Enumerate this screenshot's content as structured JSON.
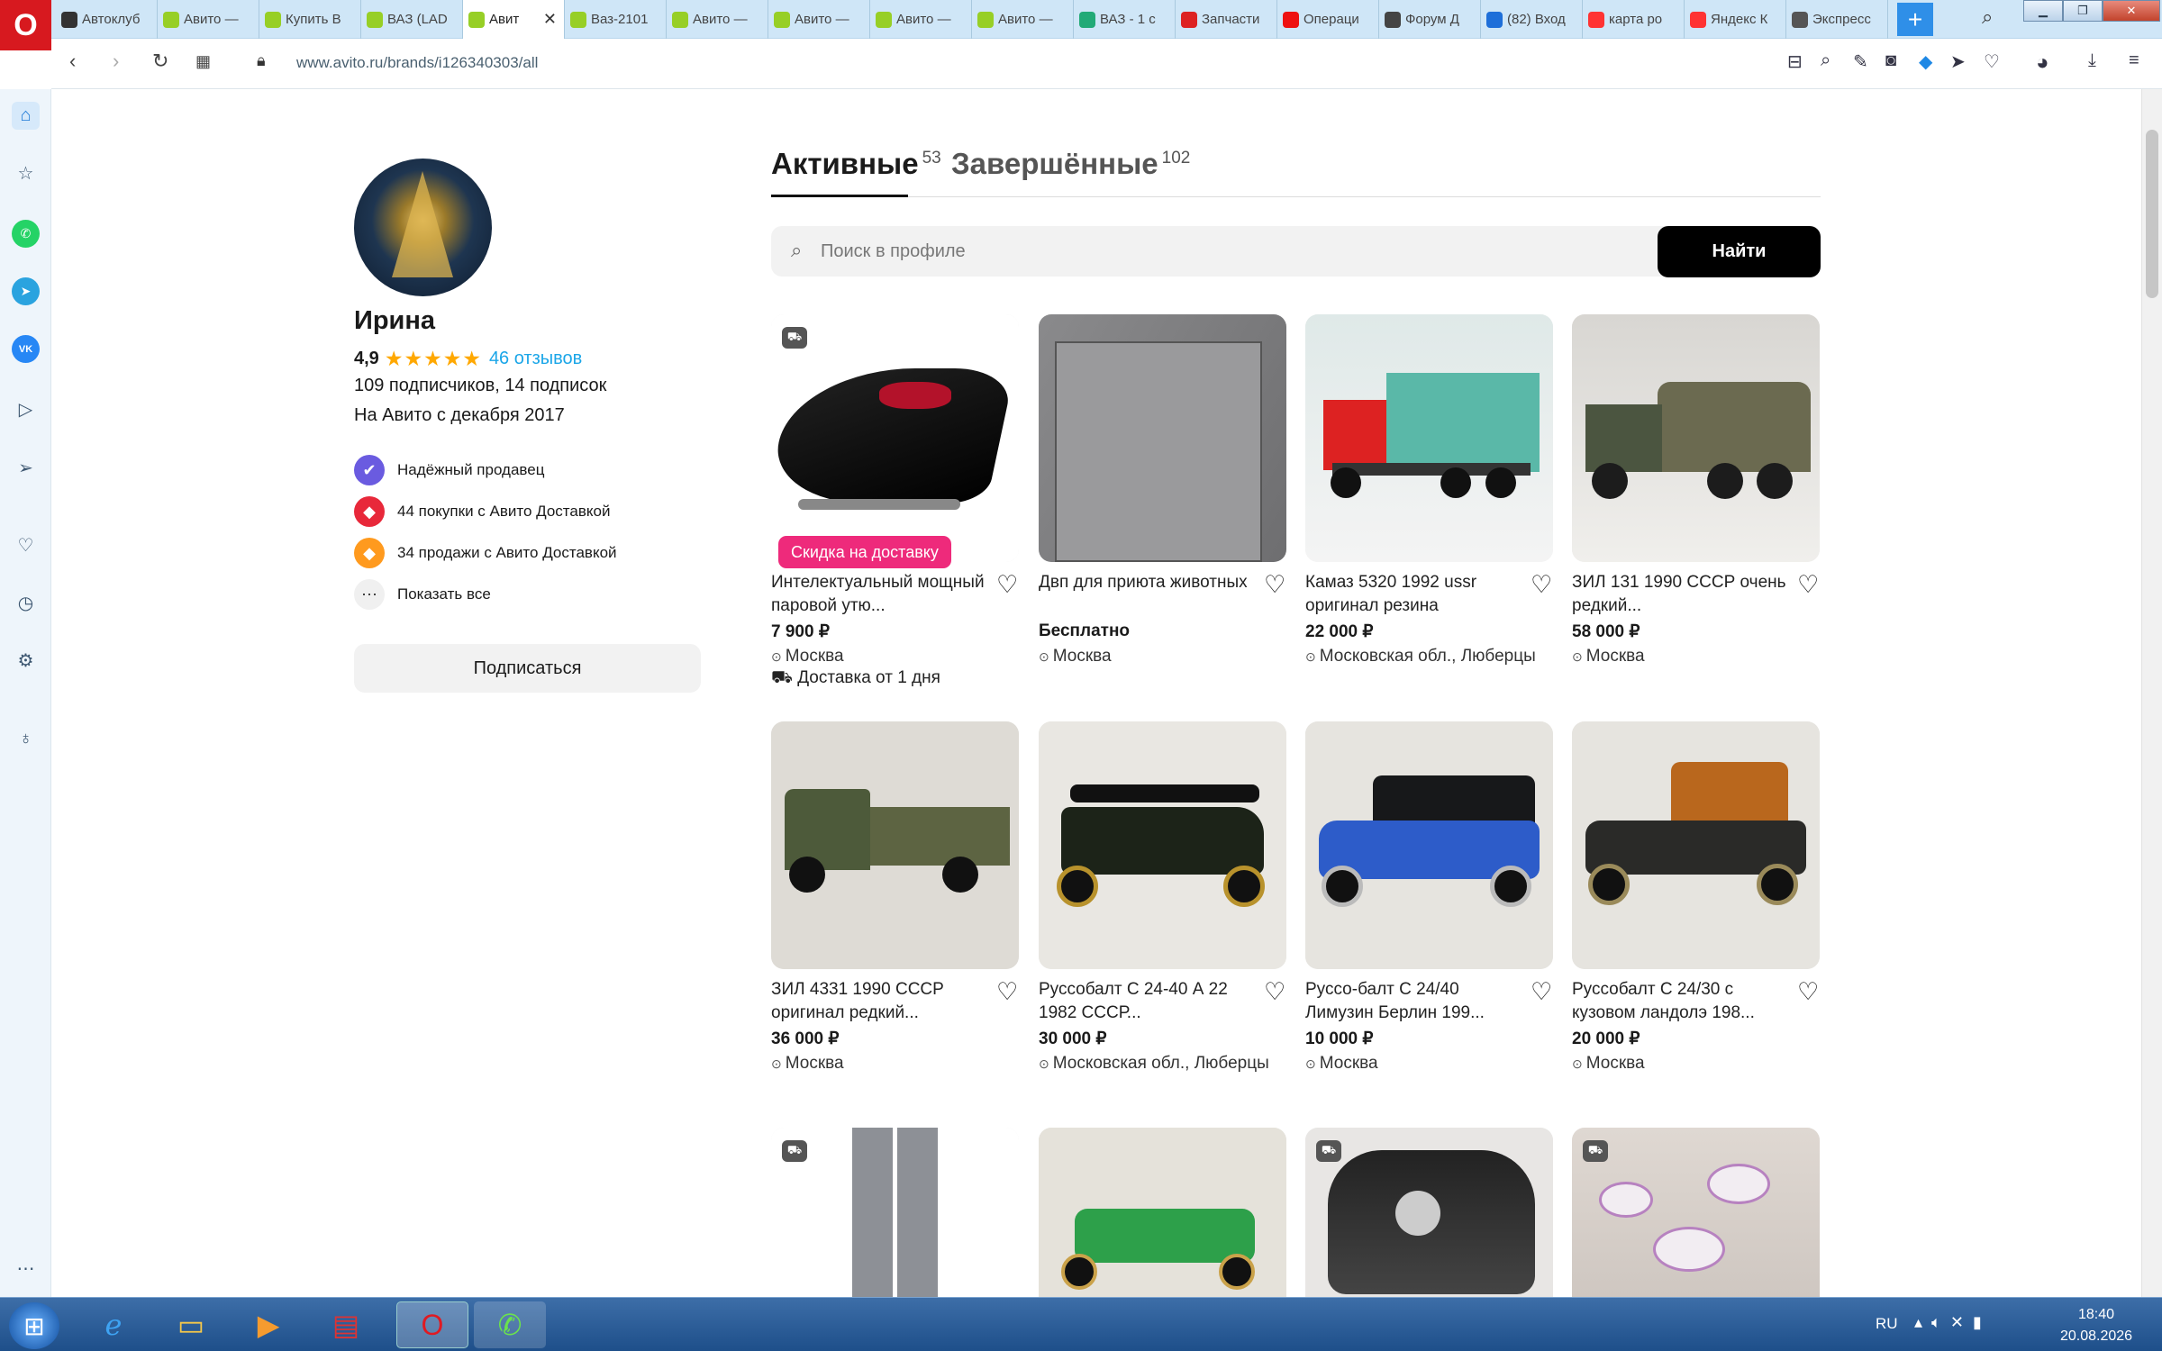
{
  "browser": {
    "tabs": [
      {
        "label": "Автоклуб",
        "icon_color": "#333"
      },
      {
        "label": "Авито —",
        "icon_color": "#97cf26"
      },
      {
        "label": "Купить В",
        "icon_color": "#97cf26"
      },
      {
        "label": "ВАЗ (LAD",
        "icon_color": "#97cf26"
      },
      {
        "label": "Авит",
        "icon_color": "#97cf26",
        "active": true
      },
      {
        "label": "Ваз-2101",
        "icon_color": "#97cf26"
      },
      {
        "label": "Авито —",
        "icon_color": "#97cf26"
      },
      {
        "label": "Авито —",
        "icon_color": "#97cf26"
      },
      {
        "label": "Авито —",
        "icon_color": "#97cf26"
      },
      {
        "label": "Авито —",
        "icon_color": "#97cf26"
      },
      {
        "label": "ВАЗ - 1 с",
        "icon_color": "#2a7"
      },
      {
        "label": "Запчасти",
        "icon_color": "#d22"
      },
      {
        "label": "Операци",
        "icon_color": "#e11"
      },
      {
        "label": "Форум Д",
        "icon_color": "#444"
      },
      {
        "label": "(82) Вход",
        "icon_color": "#1e6fd9"
      },
      {
        "label": "карта ро",
        "icon_color": "#f33"
      },
      {
        "label": "Яндекс К",
        "icon_color": "#f33"
      },
      {
        "label": "Экспресс",
        "icon_color": "#555"
      }
    ],
    "url": "www.avito.ru/brands/i126340303/all"
  },
  "profile": {
    "name": "Ирина",
    "rating": "4,9",
    "reviews": "46 отзывов",
    "subscribers": "109 подписчиков, 14 подписок",
    "since": "На Авито с декабря 2017",
    "badges": [
      {
        "label": "Надёжный продавец",
        "color": "#6a5be0"
      },
      {
        "label": "44 покупки с Авито Доставкой",
        "color": "#e8283a"
      },
      {
        "label": "34 продажи с Авито Доставкой",
        "color": "#ff9a1e"
      },
      {
        "label": "Показать все",
        "color": "#f0f0f0"
      }
    ],
    "subscribe_label": "Подписаться"
  },
  "listing_tabs": {
    "active_label": "Активные",
    "active_count": "53",
    "done_label": "Завершённые",
    "done_count": "102"
  },
  "search": {
    "placeholder": "Поиск в профиле",
    "button": "Найти"
  },
  "items": [
    {
      "title": "Интелектуальный мощный паровой утю...",
      "price": "7 900 ₽",
      "location": "Москва",
      "extra": "Доставка от 1 дня",
      "promo": "Скидка на доставку",
      "delivery": true,
      "img": "iron"
    },
    {
      "title": "Двп для приюта животных",
      "price": "Бесплатно",
      "location": "Москва",
      "img": "board"
    },
    {
      "title": "Камаз 5320 1992 ussr оригинал резина",
      "price": "22 000 ₽",
      "location": "Московская обл., Люберцы",
      "img": "kamaz"
    },
    {
      "title": "ЗИЛ 131 1990 СССР очень редкий...",
      "price": "58 000 ₽",
      "location": "Москва",
      "img": "zil131"
    },
    {
      "title": "ЗИЛ 4331 1990 СССР оригинал редкий...",
      "price": "36 000 ₽",
      "location": "Москва",
      "img": "zil4331"
    },
    {
      "title": "Руссобалт С 24-40 А 22 1982 СССР...",
      "price": "30 000 ₽",
      "location": "Московская обл., Люберцы",
      "img": "car-black"
    },
    {
      "title": "Руссо-балт С 24/40 Лимузин Берлин 199...",
      "price": "10 000 ₽",
      "location": "Москва",
      "img": "car-blue"
    },
    {
      "title": "Руссобалт С 24/30 с кузовом ландолэ 198...",
      "price": "20 000 ₽",
      "location": "Москва",
      "img": "car-orange"
    },
    {
      "title": "",
      "price": "",
      "location": "",
      "delivery": true,
      "img": "pants"
    },
    {
      "title": "",
      "price": "",
      "location": "",
      "img": "car-green"
    },
    {
      "title": "",
      "price": "",
      "location": "",
      "delivery": true,
      "img": "iron2"
    },
    {
      "title": "",
      "price": "",
      "location": "",
      "delivery": true,
      "img": "dishes"
    }
  ],
  "taskbar": {
    "lang": "RU",
    "time": "18:40",
    "date": "20.08.2026"
  }
}
